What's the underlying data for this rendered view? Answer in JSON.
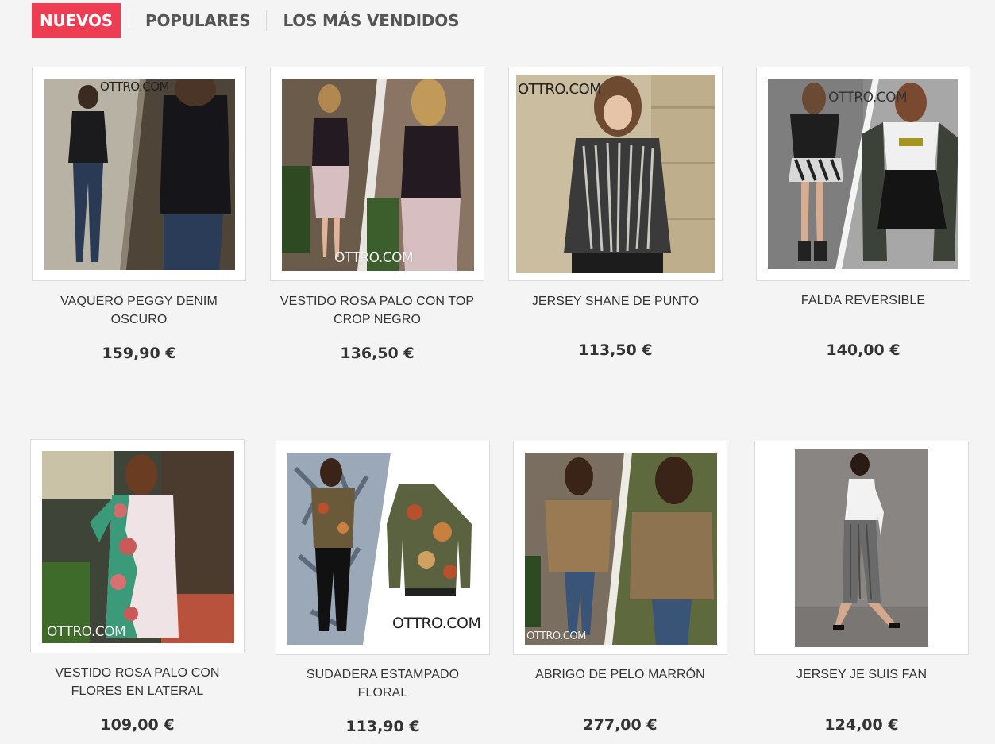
{
  "tabs": [
    "NUEVOS",
    "POPULARES",
    "LOS MÁS VENDIDOS"
  ],
  "brand_watermark": "OTTRO.COM",
  "products": [
    {
      "name": "VAQUERO PEGGY DENIM OSCURO",
      "price": "159,90 €"
    },
    {
      "name": "VESTIDO ROSA PALO CON TOP CROP NEGRO",
      "price": "136,50 €"
    },
    {
      "name": "JERSEY SHANE DE PUNTO",
      "price": "113,50 €"
    },
    {
      "name": "FALDA REVERSIBLE",
      "price": "140,00 €"
    },
    {
      "name": "VESTIDO ROSA PALO CON FLORES EN LATERAL",
      "price": "109,00 €"
    },
    {
      "name": "SUDADERA ESTAMPADO FLORAL",
      "price": "113,90 €"
    },
    {
      "name": "ABRIGO DE PELO MARRÓN",
      "price": "277,00 €"
    },
    {
      "name": "JERSEY JE SUIS FAN",
      "price": "124,00 €"
    }
  ]
}
